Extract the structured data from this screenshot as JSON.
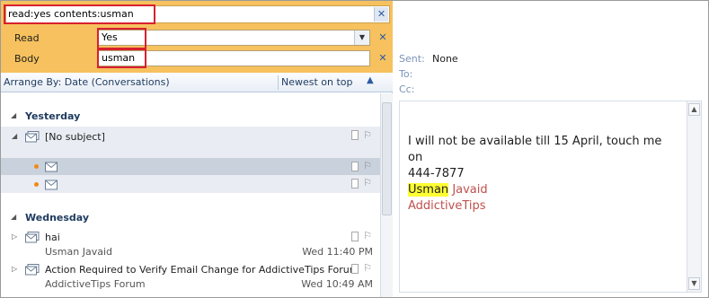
{
  "search": {
    "query": "read:yes contents:usman",
    "clear_icon": "close-icon"
  },
  "criteria": [
    {
      "label": "Read",
      "value": "Yes"
    },
    {
      "label": "Body",
      "value": "usman"
    }
  ],
  "arrange": {
    "by_label": "Arrange By: Date (Conversations)",
    "order_label": "Newest on top"
  },
  "groups": [
    {
      "name": "Yesterday",
      "items": [
        {
          "subject": "[No subject]"
        }
      ]
    },
    {
      "name": "Wednesday",
      "items": [
        {
          "subject": "hai",
          "sender": "Usman Javaid",
          "date": "Wed 11:40 PM"
        },
        {
          "subject": "Action Required to Verify Email Change for AddictiveTips Forum",
          "sender": "AddictiveTips Forum",
          "date": "Wed 10:49 AM"
        }
      ]
    }
  ],
  "reading": {
    "sent_label": "Sent:",
    "sent_value": "None",
    "to_label": "To:",
    "cc_label": "Cc:",
    "body_line1": "I will not be available till 15 April, touch me on",
    "body_line2": "444-7877",
    "sig_first": "Usman",
    "sig_last": "Javaid",
    "sig_company": "AddictiveTips"
  },
  "colors": {
    "search_bg": "#f6c15e",
    "highlight": "#ffff33",
    "annotation_box": "#d8202e",
    "signature": "#c0504d",
    "unread_dot": "#f08a18"
  }
}
